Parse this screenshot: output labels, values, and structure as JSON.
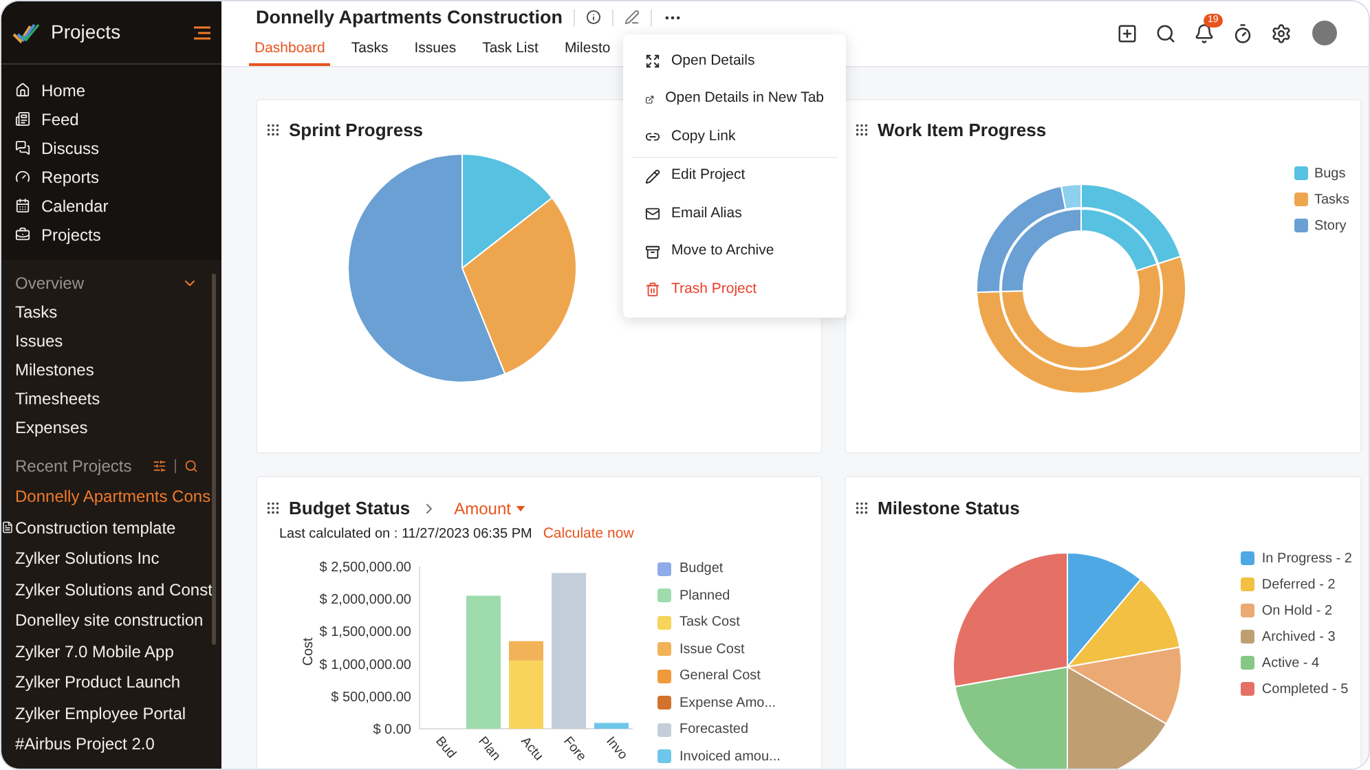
{
  "sidebar": {
    "app_name": "Projects",
    "nav": [
      "Home",
      "Feed",
      "Discuss",
      "Reports",
      "Calendar",
      "Projects"
    ],
    "overview": {
      "title": "Overview",
      "expanded": true,
      "items": [
        "Tasks",
        "Issues",
        "Milestones",
        "Timesheets",
        "Expenses"
      ]
    },
    "recent": {
      "title": "Recent Projects",
      "items": [
        {
          "label": "Donnelly Apartments Cons",
          "selected": true,
          "template": false
        },
        {
          "label": "Construction template",
          "selected": false,
          "template": true
        },
        {
          "label": "Zylker Solutions Inc",
          "selected": false,
          "template": false
        },
        {
          "label": "Zylker Solutions and Const",
          "selected": false,
          "template": false
        },
        {
          "label": "Donelley site construction",
          "selected": false,
          "template": false
        },
        {
          "label": "Zylker 7.0 Mobile App",
          "selected": false,
          "template": false
        },
        {
          "label": "Zylker Product Launch",
          "selected": false,
          "template": false
        },
        {
          "label": "Zylker Employee Portal",
          "selected": false,
          "template": false
        },
        {
          "label": "#Airbus Project 2.0",
          "selected": false,
          "template": false
        }
      ]
    }
  },
  "header": {
    "title": "Donnelly Apartments Construction",
    "notification_count": "19",
    "tabs": [
      {
        "label": "Dashboard",
        "selected": true
      },
      {
        "label": "Tasks",
        "selected": false
      },
      {
        "label": "Issues",
        "selected": false
      },
      {
        "label": "Task List",
        "selected": false
      },
      {
        "label": "Milesto",
        "selected": false
      }
    ]
  },
  "menu": {
    "items": [
      {
        "label": "Open Details",
        "kind": "normal"
      },
      {
        "label": "Open Details in New Tab",
        "kind": "normal"
      },
      {
        "label": "Copy Link",
        "kind": "normal"
      },
      {
        "label": "Edit Project",
        "kind": "normal"
      },
      {
        "label": "Email Alias",
        "kind": "normal"
      },
      {
        "label": "Move to Archive",
        "kind": "normal"
      },
      {
        "label": "Trash Project",
        "kind": "danger"
      }
    ]
  },
  "sprint_progress": {
    "title": "Sprint Progress"
  },
  "work_item_progress": {
    "title": "Work Item Progress",
    "legend": [
      {
        "label": "Bugs",
        "color": "#56c1e0"
      },
      {
        "label": "Tasks",
        "color": "#eea64e"
      },
      {
        "label": "Story",
        "color": "#6aa0d4"
      }
    ]
  },
  "budget_status": {
    "title": "Budget Status",
    "view": "Amount",
    "last_calculated": "Last calculated on : 11/27/2023 06:35 PM",
    "action": "Calculate now",
    "chart_data": {
      "type": "bar",
      "ylabel": "Cost",
      "stacked": true,
      "categories": [
        "Bud",
        "Plan",
        "Actu",
        "Fore",
        "Invo"
      ],
      "ylim": [
        0,
        2500000
      ],
      "yticks": [
        {
          "value": 0,
          "label": "$ 0.00"
        },
        {
          "value": 500000,
          "label": "$ 500,000.00"
        },
        {
          "value": 1000000,
          "label": "$ 1,000,000.00"
        },
        {
          "value": 1500000,
          "label": "$ 1,500,000.00"
        },
        {
          "value": 2000000,
          "label": "$ 2,000,000.00"
        },
        {
          "value": 2500000,
          "label": "$ 2,500,000.00"
        }
      ],
      "series": [
        {
          "name": "Budget",
          "color": "#8eaaea",
          "values": [
            0,
            null,
            null,
            null,
            null
          ]
        },
        {
          "name": "Planned",
          "color": "#9edcad",
          "values": [
            null,
            2050000,
            null,
            null,
            null
          ]
        },
        {
          "name": "Task Cost",
          "color": "#f8d45c",
          "values": [
            null,
            null,
            1050000,
            null,
            null
          ]
        },
        {
          "name": "Issue Cost",
          "color": "#f2b257",
          "values": [
            null,
            null,
            300000,
            null,
            null
          ]
        },
        {
          "name": "General Cost",
          "color": "#ef9a3c",
          "values": [
            null,
            null,
            null,
            null,
            null
          ]
        },
        {
          "name": "Expense Amo...",
          "color": "#d2722c",
          "values": [
            null,
            null,
            null,
            null,
            null
          ]
        },
        {
          "name": "Forecasted",
          "color": "#c3ceda",
          "values": [
            null,
            null,
            null,
            2400000,
            null
          ]
        },
        {
          "name": "Invoiced amou...",
          "color": "#6ec6ea",
          "values": [
            null,
            null,
            null,
            null,
            90000
          ]
        }
      ]
    }
  },
  "milestone_status": {
    "title": "Milestone Status",
    "chart_data": {
      "type": "pie",
      "categories": [
        "In Progress - 2",
        "Deferred - 2",
        "On Hold - 2",
        "Archived - 3",
        "Active - 4",
        "Completed - 5"
      ],
      "values": [
        11.11,
        11.11,
        11.11,
        16.67,
        22.22,
        27.78
      ]
    },
    "slices": [
      {
        "color": "#4ea8e4"
      },
      {
        "color": "#f2c043"
      },
      {
        "color": "#eba974"
      },
      {
        "color": "#bf9f72"
      },
      {
        "color": "#86c787"
      },
      {
        "color": "#e57065"
      }
    ]
  }
}
